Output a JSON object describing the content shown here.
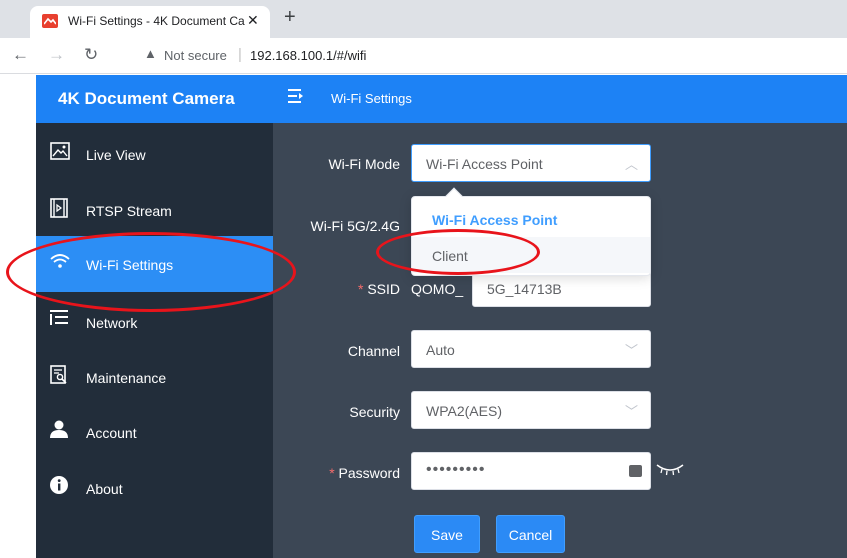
{
  "browser": {
    "tab_title": "Wi-Fi Settings - 4K Document Ca",
    "tab_close": "✕",
    "new_tab": "+",
    "security_label": "Not secure",
    "url": "192.168.100.1/#/wifi",
    "url_separator": "|"
  },
  "header": {
    "app_title": "4K Document Camera",
    "page_title": "Wi-Fi Settings"
  },
  "sidebar": {
    "items": [
      {
        "label": "Live View",
        "icon": "image-icon"
      },
      {
        "label": "RTSP Stream",
        "icon": "film-play-icon"
      },
      {
        "label": "Wi-Fi Settings",
        "icon": "wifi-icon",
        "active": true
      },
      {
        "label": "Network",
        "icon": "list-icon"
      },
      {
        "label": "Maintenance",
        "icon": "document-search-icon"
      },
      {
        "label": "Account",
        "icon": "user-icon"
      },
      {
        "label": "About",
        "icon": "info-icon"
      }
    ]
  },
  "form": {
    "wifi_mode": {
      "label": "Wi-Fi Mode",
      "value": "Wi-Fi Access Point"
    },
    "band": {
      "label": "Wi-Fi 5G/2.4G"
    },
    "ssid": {
      "required_mark": "*",
      "label": "SSID",
      "prefix": "QOMO_",
      "value": "5G_14713B"
    },
    "channel": {
      "label": "Channel",
      "value": "Auto"
    },
    "security": {
      "label": "Security",
      "value": "WPA2(AES)"
    },
    "password": {
      "required_mark": "*",
      "label": "Password",
      "value": "•••••••••"
    },
    "save_label": "Save",
    "cancel_label": "Cancel"
  },
  "dropdown": {
    "options": [
      {
        "label": "Wi-Fi Access Point",
        "selected": true
      },
      {
        "label": "Client",
        "hovered": true
      }
    ]
  },
  "colors": {
    "header_blue": "#1d82f5",
    "sidebar_dark": "#222d3a",
    "sidebar_active": "#2c8ef5",
    "main_bg": "#3c4755",
    "annotation_red": "#e8141b"
  }
}
